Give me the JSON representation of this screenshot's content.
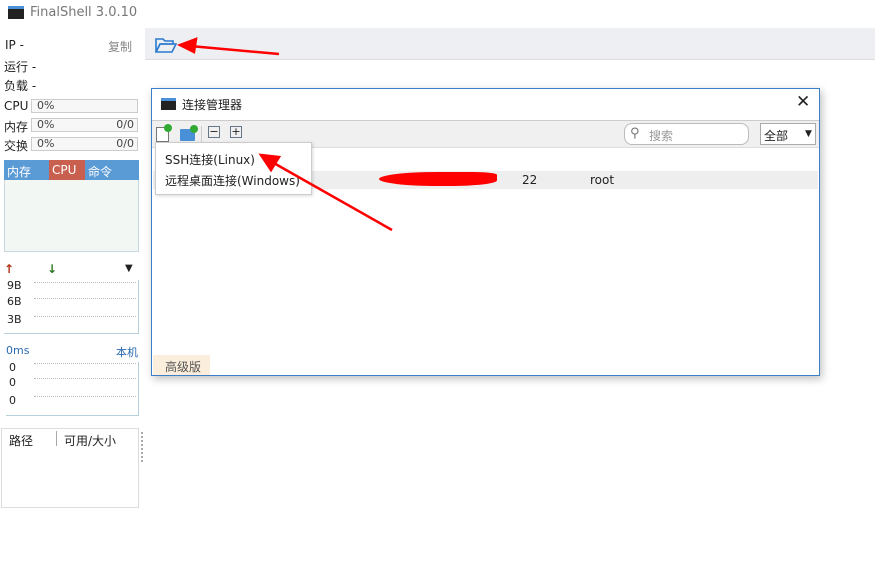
{
  "app": {
    "title": "FinalShell 3.0.10"
  },
  "info": {
    "ip_label": "IP  -",
    "copy_label": "复制",
    "run_label": "运行 -",
    "load_label": "负载 -"
  },
  "resources": [
    {
      "label": "CPU",
      "percent": "0%",
      "value": ""
    },
    {
      "label": "内存",
      "percent": "0%",
      "value": "0/0"
    },
    {
      "label": "交换",
      "percent": "0%",
      "value": "0/0"
    }
  ],
  "tabs": [
    "内存",
    "CPU",
    "命令"
  ],
  "tab_colors": {
    "mem": "#5b9bd5",
    "cpu": "#c9604f",
    "cmd": "#5b9bd5"
  },
  "network": {
    "ticks": [
      "9B",
      "6B",
      "3B"
    ]
  },
  "ping": {
    "latency": "0ms",
    "host": "本机",
    "ticks": [
      "0",
      "0",
      "0"
    ]
  },
  "files": {
    "columns": [
      "路径",
      "可用/大小"
    ]
  },
  "dialog": {
    "title": "连接管理器",
    "search_placeholder": "搜索",
    "filter": "全部",
    "menu": [
      "SSH连接(Linux)",
      "远程桌面连接(Windows)"
    ],
    "row": {
      "port": "22",
      "user": "root"
    },
    "bottom_tab": "高级版"
  }
}
